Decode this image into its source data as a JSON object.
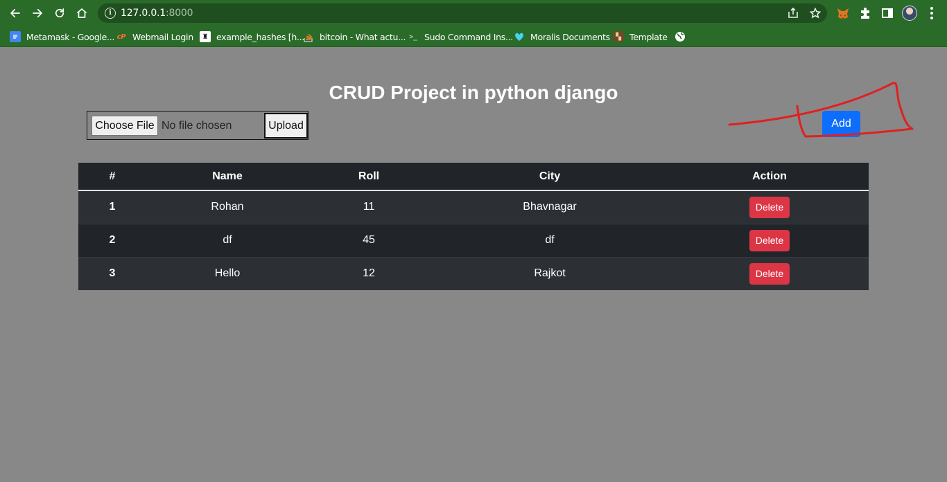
{
  "browser": {
    "url_host": "127.0.0.1",
    "url_port": ":8000",
    "bookmarks": [
      {
        "label": "Metamask - Google...",
        "icon": "docs-icon"
      },
      {
        "label": "Webmail Login",
        "icon": "cpanel-icon"
      },
      {
        "label": "example_hashes [h...",
        "icon": "hashcat-icon"
      },
      {
        "label": "bitcoin - What actu...",
        "icon": "stackoverflow-icon"
      },
      {
        "label": "Sudo Command Ins...",
        "icon": "terminal-icon"
      },
      {
        "label": "Moralis Documents",
        "icon": "moralis-icon"
      },
      {
        "label": "Template",
        "icon": "template-icon"
      }
    ]
  },
  "page": {
    "title": "CRUD Project in python django",
    "file_input": {
      "button_label": "Choose File",
      "status": "No file chosen"
    },
    "upload_label": "Upload",
    "add_label": "Add"
  },
  "table": {
    "headers": [
      "#",
      "Name",
      "Roll",
      "City",
      "Action"
    ],
    "rows": [
      {
        "id": "1",
        "name": "Rohan",
        "roll": "11",
        "city": "Bhavnagar",
        "action": "Delete"
      },
      {
        "id": "2",
        "name": "df",
        "roll": "45",
        "city": "df",
        "action": "Delete"
      },
      {
        "id": "3",
        "name": "Hello",
        "roll": "12",
        "city": "Rajkot",
        "action": "Delete"
      }
    ]
  },
  "colors": {
    "page_background": "#888888",
    "browser_chrome": "#2a6b2a",
    "add_button": "#0d6efd",
    "delete_button": "#dc3545",
    "table_dark": "#212529",
    "annotation_stroke": "#e02020"
  }
}
